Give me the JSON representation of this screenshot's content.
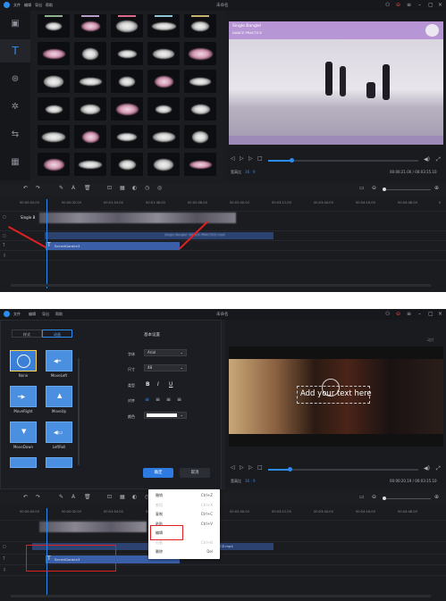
{
  "shot1": {
    "title": "未命名",
    "menu": [
      "文件",
      "编辑",
      "导出",
      "帮助"
    ],
    "video_overlay_title": "Single Bangle!",
    "video_overlay_subtitle": "DANCE PRACTICE",
    "aspect_label": "宽高比",
    "aspect_value": "16 : 9",
    "time_display": "00:00:21.00 / 00:03:15.10",
    "ruler_ticks": [
      "00:00:00.00",
      "00:00:32.00",
      "00:01:04.00",
      "00:01:36.00",
      "00:02:08.00",
      "00:02:40.00",
      "00:03:12.00",
      "00:03:44.00",
      "00:04:16.00",
      "00:04:48.00",
      "0"
    ],
    "track_label": "Single B",
    "text_clip": "SecretGarden3",
    "audio_clip_hint": "Single Bangle! DANCE PRACTICE.mp4"
  },
  "shot2": {
    "title": "未命名",
    "menu": [
      "文件",
      "编辑",
      "导出",
      "帮助"
    ],
    "tabs": [
      "样式",
      "动画"
    ],
    "animations": [
      "None",
      "MoveLeft",
      "MoveRight",
      "MoveUp",
      "MoveDown",
      "LeftRoll"
    ],
    "settings_title": "基本设置",
    "font_label": "字体",
    "font_value": "Arial",
    "size_label": "尺寸",
    "size_value": "48",
    "style_label": "类型",
    "style_b": "B",
    "style_i": "I",
    "style_u": "U",
    "align_label": "对齐",
    "color_label": "颜色",
    "ok_button": "确定",
    "cancel_button": "取消",
    "preview_text": "Add your text here",
    "aspect_label": "宽高比",
    "aspect_value": "16 : 9",
    "time_display": "00:00:20.19 / 00:03:15.10",
    "context_menu": [
      {
        "label": "撤销",
        "key": "Ctrl+Z",
        "disabled": false
      },
      {
        "label": "剪切",
        "key": "Ctrl+X",
        "disabled": true
      },
      {
        "label": "复制",
        "key": "Ctrl+C",
        "disabled": false
      },
      {
        "label": "粘贴",
        "key": "Ctrl+V",
        "disabled": false
      },
      {
        "label": "编辑",
        "key": "",
        "disabled": false
      },
      {
        "label": "分割",
        "key": "Ctrl+B",
        "disabled": true
      },
      {
        "label": "删除",
        "key": "Del",
        "disabled": false
      }
    ],
    "ruler_ticks": [
      "00:00:00.00",
      "00:00:32.00",
      "00:01:04.00",
      "00:01:36.00",
      "00:02:08.00",
      "00:02:40.00",
      "00:03:12.00",
      "00:03:44.00",
      "00:04:16.00",
      "00:04:48.00"
    ],
    "text_clip": "SecretGarden3",
    "video_clip_suffix": "CE.mp4",
    "watermark": "动片"
  },
  "colors": {
    "accent": "#2d8cf0",
    "clip": "#3a5fa8",
    "highlight": "#e02020"
  }
}
